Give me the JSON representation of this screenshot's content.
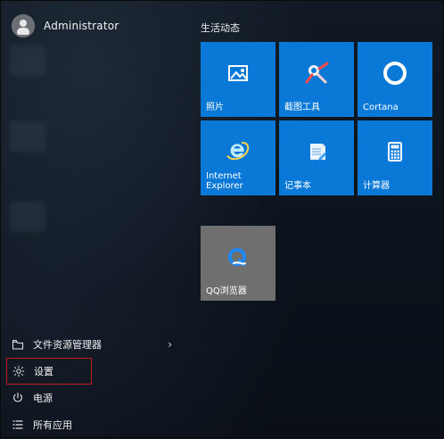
{
  "user": {
    "name": "Administrator"
  },
  "left_menu": {
    "items": [
      {
        "label": "文件资源管理器",
        "icon": "folder-icon",
        "has_chevron": true
      },
      {
        "label": "设置",
        "icon": "gear-icon",
        "selected": true
      },
      {
        "label": "电源",
        "icon": "power-icon"
      },
      {
        "label": "所有应用",
        "icon": "list-icon"
      }
    ],
    "chevron": "›"
  },
  "right": {
    "group_title": "生活动态",
    "tiles": [
      {
        "label": "照片",
        "icon": "photos-icon",
        "accent": "#0a78d7"
      },
      {
        "label": "截图工具",
        "icon": "snipping-tool-icon",
        "accent": "#0a78d7"
      },
      {
        "label": "Cortana",
        "icon": "cortana-icon",
        "accent": "#0a78d7"
      },
      {
        "label": "Internet\nExplorer",
        "icon": "internet-explorer-icon",
        "accent": "#0a78d7"
      },
      {
        "label": "记事本",
        "icon": "notepad-icon",
        "accent": "#0a78d7"
      },
      {
        "label": "计算器",
        "icon": "calculator-icon",
        "accent": "#0a78d7"
      },
      {
        "label": "QQ浏览器",
        "icon": "qq-browser-icon",
        "accent": "#6f6f6f"
      }
    ]
  },
  "colors": {
    "tile_blue": "#0a78d7",
    "highlight_red": "#c21d1d",
    "tile_gray": "#6f6f6f"
  }
}
